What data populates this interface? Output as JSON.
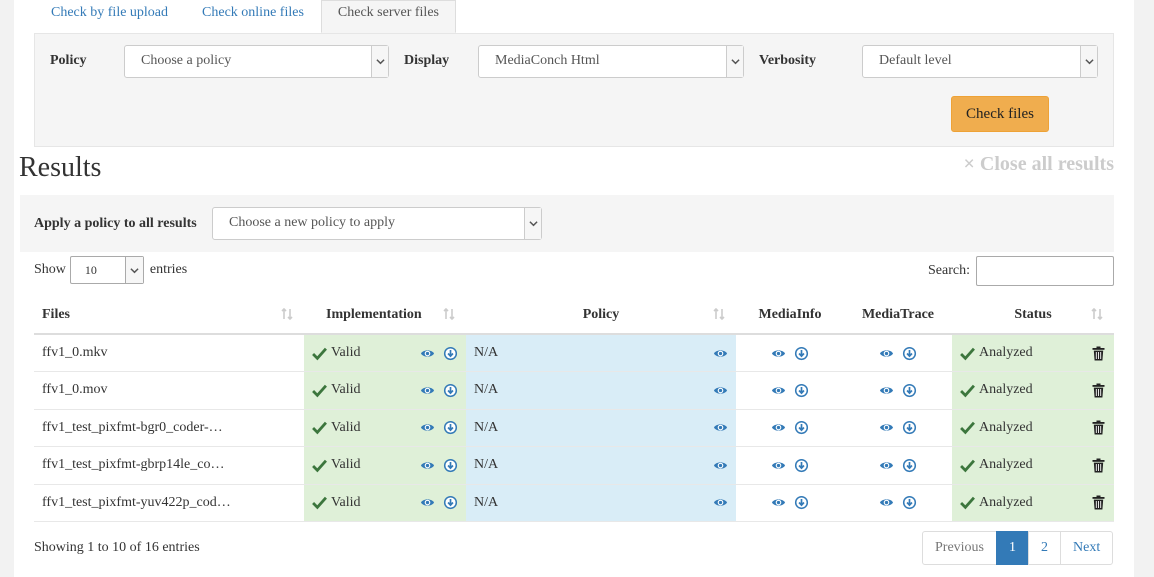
{
  "tabs": [
    {
      "label": "Check by file upload"
    },
    {
      "label": "Check online files"
    },
    {
      "label": "Check server files"
    }
  ],
  "server_form": {
    "policy_label": "Policy",
    "policy_value": "Choose a policy",
    "display_label": "Display",
    "display_value": "MediaConch Html",
    "verbosity_label": "Verbosity",
    "verbosity_value": "Default level",
    "check_button": "Check files"
  },
  "results": {
    "title": "Results",
    "close_all": "× Close all results",
    "apply_label": "Apply a policy to all results",
    "apply_value": "Choose a new policy to apply",
    "show_label": "Show",
    "entries_value": "10",
    "entries_label": "entries",
    "search_label": "Search:",
    "columns": [
      "Files",
      "Implementation",
      "Policy",
      "MediaInfo",
      "MediaTrace",
      "Status"
    ],
    "rows": [
      {
        "file": "ffv1_0.mkv",
        "implementation": "Valid",
        "policy": "N/A",
        "status": "Analyzed"
      },
      {
        "file": "ffv1_0.mov",
        "implementation": "Valid",
        "policy": "N/A",
        "status": "Analyzed"
      },
      {
        "file": "ffv1_test_pixfmt-bgr0_coder-…",
        "implementation": "Valid",
        "policy": "N/A",
        "status": "Analyzed"
      },
      {
        "file": "ffv1_test_pixfmt-gbrp14le_co…",
        "implementation": "Valid",
        "policy": "N/A",
        "status": "Analyzed"
      },
      {
        "file": "ffv1_test_pixfmt-yuv422p_cod…",
        "implementation": "Valid",
        "policy": "N/A",
        "status": "Analyzed"
      }
    ],
    "info": "Showing 1 to 10 of 16 entries",
    "pagination": {
      "previous": "Previous",
      "pages": [
        "1",
        "2"
      ],
      "active_page": "1",
      "next": "Next"
    }
  },
  "colors": {
    "accent": "#337ab7",
    "check_button": "#f0ad4e",
    "valid_bg": "#dff0d8",
    "policy_bg": "#d9edf7"
  },
  "icons": {
    "view": "eye-icon",
    "download": "download-icon",
    "valid": "check-icon",
    "delete": "trash-icon",
    "sort": "sort-icon",
    "dropdown": "chevron-down-icon"
  }
}
